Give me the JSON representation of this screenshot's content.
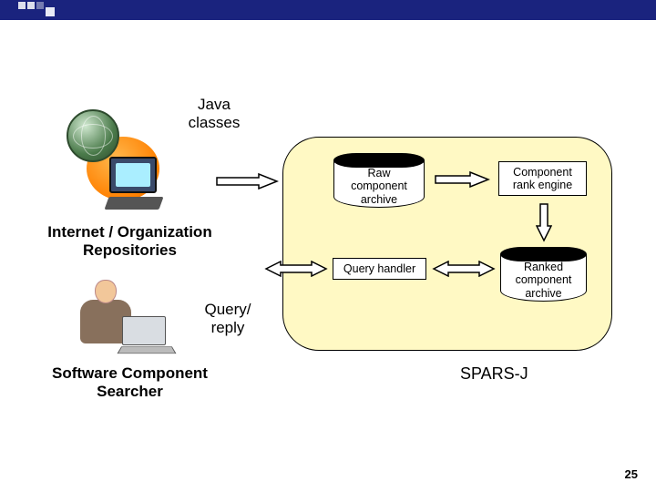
{
  "labels": {
    "java_classes": "Java\nclasses",
    "internet_repos": "Internet / Organization\nRepositories",
    "query_reply": "Query/\nreply",
    "searcher": "Software Component\nSearcher",
    "spars": "SPARS-J"
  },
  "nodes": {
    "raw_archive": "Raw\ncomponent\narchive",
    "rank_engine": "Component\nrank engine",
    "query_handler": "Query handler",
    "ranked_archive": "Ranked\ncomponent\narchive"
  },
  "page_number": "25"
}
